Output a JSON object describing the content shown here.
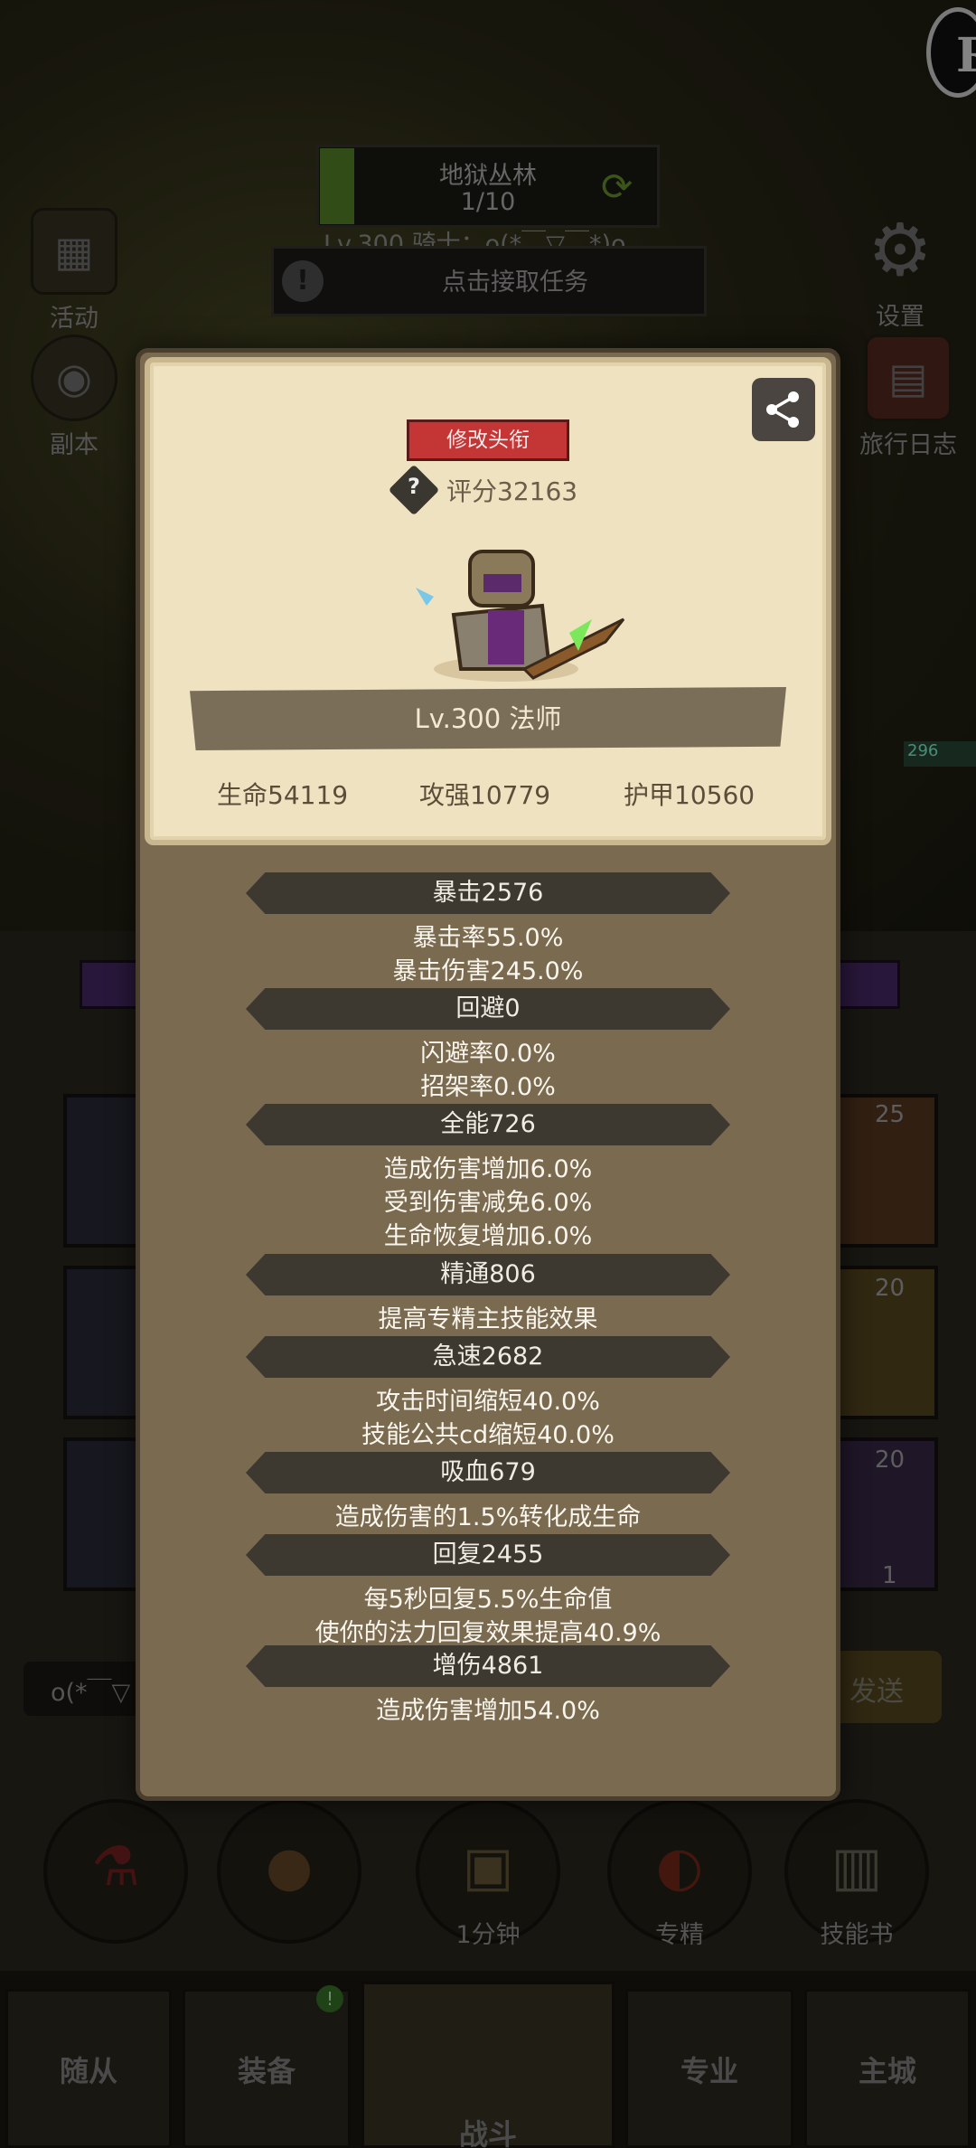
{
  "background": {
    "stage": {
      "name": "地狱丛林",
      "progress": "1/10"
    },
    "knight_line": "Lv.300 骑士：o(*￣▽￣*)o",
    "task": "点击接取任务",
    "side_left": [
      {
        "label": "活动",
        "icon": "calendar-icon"
      },
      {
        "label": "副本",
        "icon": "portal-icon"
      }
    ],
    "side_right": [
      {
        "label": "设置",
        "icon": "gear-icon"
      },
      {
        "label": "旅行日志",
        "icon": "book-icon"
      }
    ],
    "right_hp_text": "296",
    "card_numbers": [
      "25",
      "20",
      "20",
      "1"
    ],
    "chat_text": "o(*￣▽",
    "send_label": "发送",
    "round_buttons": [
      {
        "label": "",
        "icon": "potion-icon"
      },
      {
        "label": "",
        "icon": "bread-icon"
      },
      {
        "label": "1分钟",
        "icon": "chest-icon"
      },
      {
        "label": "专精",
        "icon": "spec-icon"
      },
      {
        "label": "技能书",
        "icon": "skillbook-icon"
      }
    ],
    "nav": {
      "tabs": [
        "随从",
        "装备",
        "战斗",
        "专业",
        "主城"
      ],
      "active": "战斗",
      "badge": "!"
    }
  },
  "modal": {
    "title_button": "修改头衔",
    "help": "?",
    "score": "评分32163",
    "hero_name": "Lv.300 法师",
    "stats": {
      "hp": "生命54119",
      "attack": "攻强10779",
      "armor": "护甲10560"
    },
    "sections": [
      {
        "header": "暴击2576",
        "lines": [
          "暴击率55.0%",
          "暴击伤害245.0%"
        ]
      },
      {
        "header": "回避0",
        "lines": [
          "闪避率0.0%",
          "招架率0.0%"
        ]
      },
      {
        "header": "全能726",
        "lines": [
          "造成伤害增加6.0%",
          "受到伤害减免6.0%",
          "生命恢复增加6.0%"
        ]
      },
      {
        "header": "精通806",
        "lines": [
          "提高专精主技能效果"
        ]
      },
      {
        "header": "急速2682",
        "lines": [
          "攻击时间缩短40.0%",
          "技能公共cd缩短40.0%"
        ]
      },
      {
        "header": "吸血679",
        "lines": [
          "造成伤害的1.5%转化成生命"
        ]
      },
      {
        "header": "回复2455",
        "lines": [
          "每5秒回复5.5%生命值",
          "使你的法力回复效果提高40.9%"
        ]
      },
      {
        "header": "增伤4861",
        "lines": [
          "造成伤害增加54.0%"
        ]
      }
    ]
  },
  "colors": {
    "title_button": "#c43535",
    "parchment": "#efe2c0",
    "modal_body": "#7a6a50",
    "pill": "#3d3830"
  }
}
